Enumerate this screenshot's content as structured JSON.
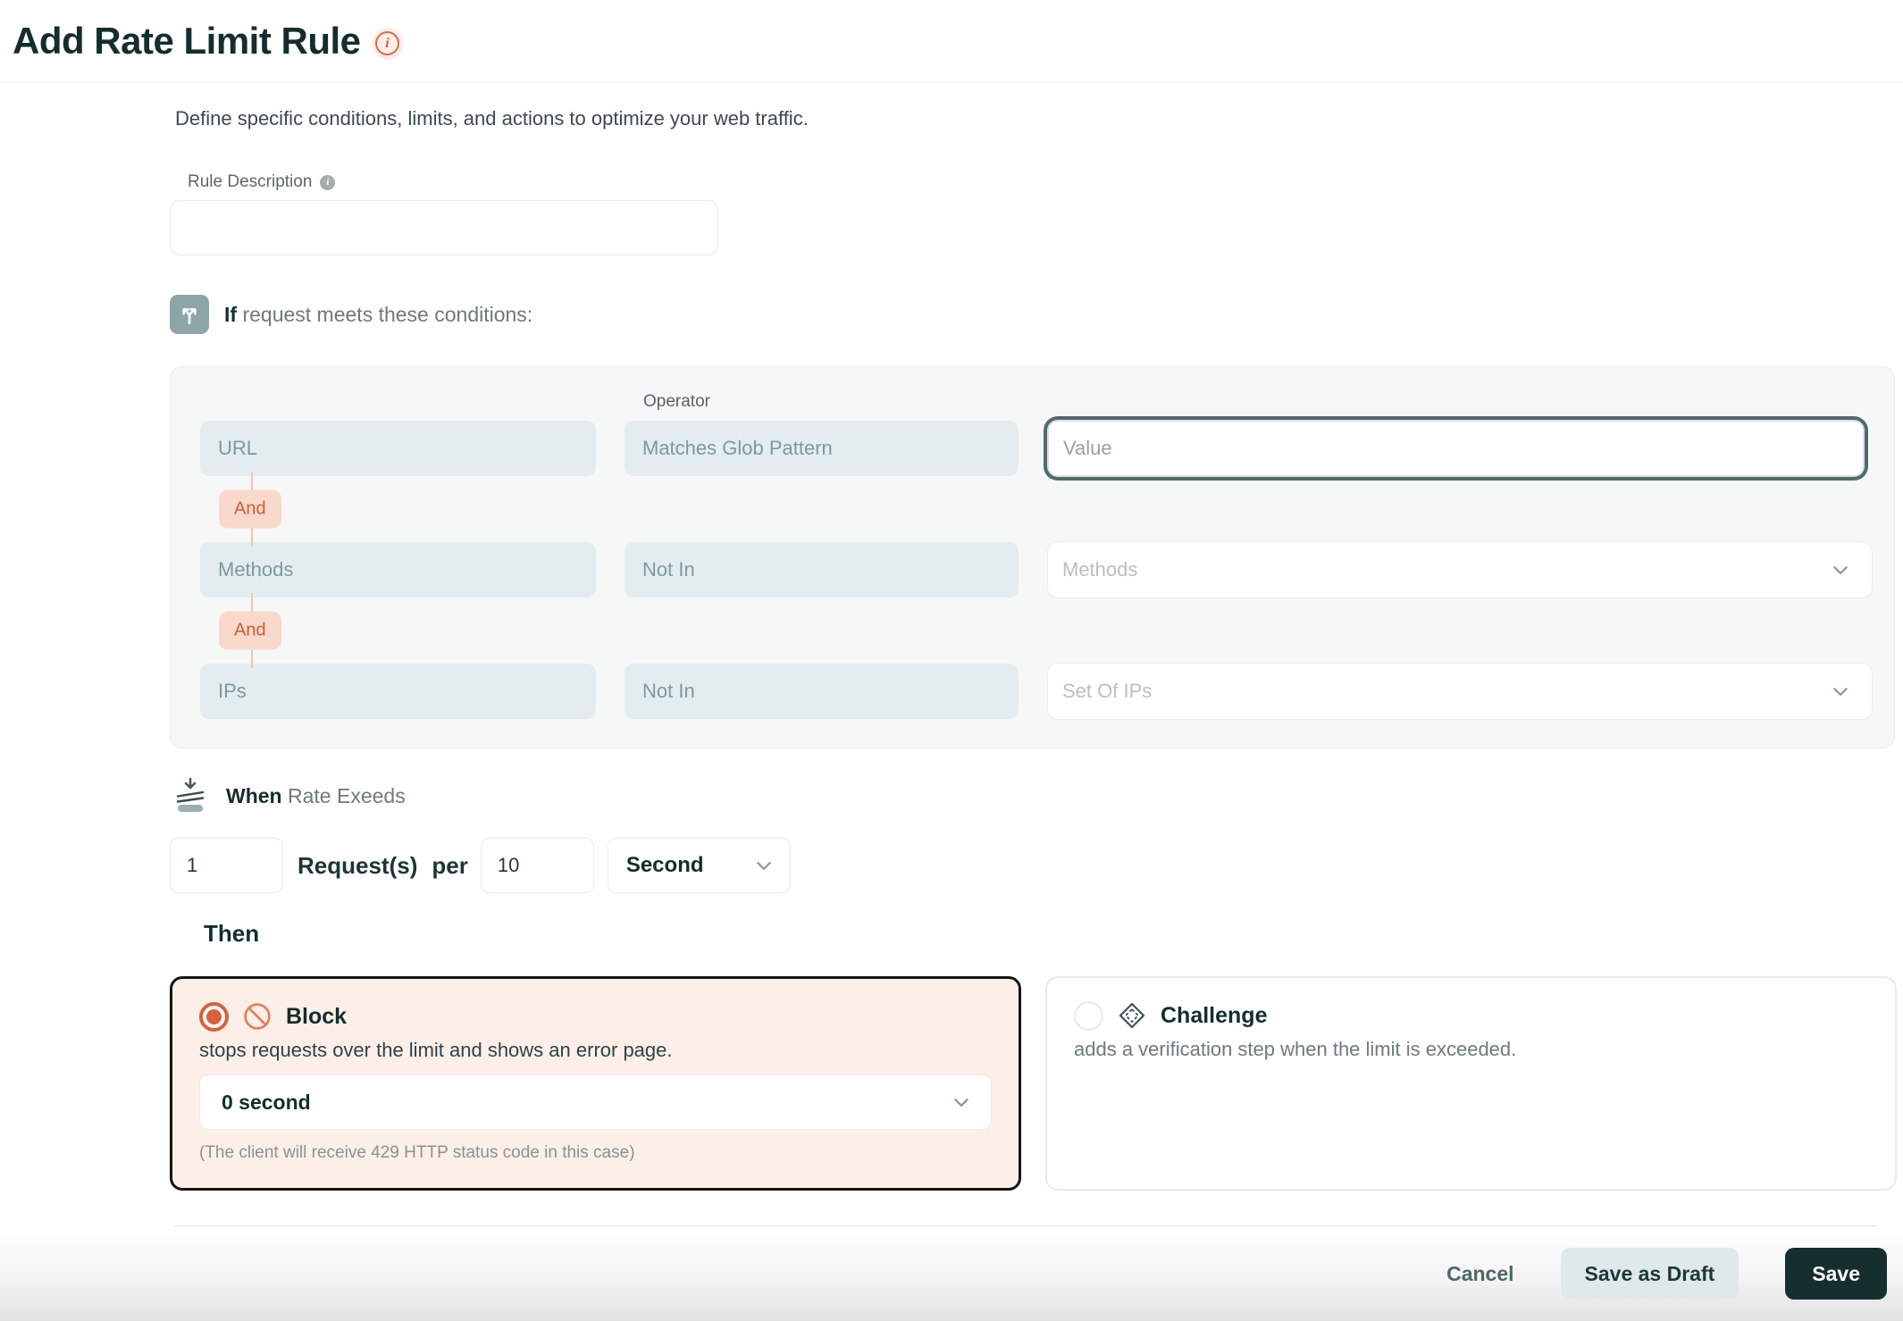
{
  "colors": {
    "accent_orange": "#d9603a",
    "dark_teal": "#132e2c",
    "pill_bg": "#e3edef",
    "and_bg": "#f9d9cb",
    "and_text": "#cf5b35",
    "focus_ring": "#53696b",
    "block_card_bg": "#fcefe8",
    "save_button_bg": "#152f2e",
    "draft_button_bg": "#dfe9e9"
  },
  "header": {
    "title": "Add Rate Limit Rule"
  },
  "intro": "Define specific conditions, limits, and actions to optimize your web traffic.",
  "rule_description": {
    "label": "Rule Description",
    "value": ""
  },
  "conditions": {
    "if_keyword": "If",
    "if_text": "request meets these conditions:",
    "operator_label": "Operator",
    "connector_label": "And",
    "rows": [
      {
        "field": "URL",
        "operator": "Matches Glob Pattern",
        "value_placeholder": "Value"
      },
      {
        "field": "Methods",
        "operator": "Not In",
        "value_placeholder": "Methods"
      },
      {
        "field": "IPs",
        "operator": "Not In",
        "value_placeholder": "Set Of IPs"
      }
    ]
  },
  "rate": {
    "when_keyword": "When",
    "when_text": "Rate Exeeds",
    "count": "1",
    "label_requests": "Request(s)",
    "label_per": "per",
    "window": "10",
    "unit": "Second"
  },
  "then": {
    "label": "Then",
    "options": [
      {
        "name": "Block",
        "description": "stops requests over the limit and shows an error page.",
        "duration": "0 second",
        "note": "(The client will receive 429 HTTP status code in this case)"
      },
      {
        "name": "Challenge",
        "description": "adds a verification step when the limit is exceeded."
      }
    ]
  },
  "footer": {
    "cancel": "Cancel",
    "save_draft": "Save as Draft",
    "save": "Save"
  }
}
